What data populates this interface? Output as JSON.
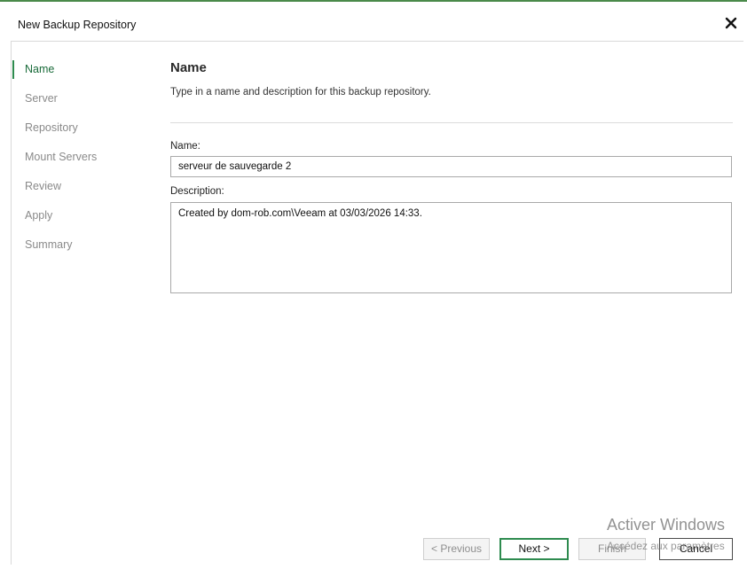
{
  "window": {
    "title": "New Backup Repository"
  },
  "icons": {
    "close": "close-icon"
  },
  "sidebar": {
    "steps": [
      {
        "label": "Name",
        "active": true
      },
      {
        "label": "Server",
        "active": false
      },
      {
        "label": "Repository",
        "active": false
      },
      {
        "label": "Mount Servers",
        "active": false
      },
      {
        "label": "Review",
        "active": false
      },
      {
        "label": "Apply",
        "active": false
      },
      {
        "label": "Summary",
        "active": false
      }
    ]
  },
  "main": {
    "title": "Name",
    "description": "Type in a name and description for this backup repository.",
    "name_label": "Name:",
    "name_value": "serveur de sauvegarde 2",
    "description_label": "Description:",
    "description_value": "Created by dom-rob.com\\Veeam at 03/03/2026 14:33."
  },
  "buttons": {
    "previous": "< Previous",
    "next": "Next >",
    "finish": "Finish",
    "cancel": "Cancel"
  },
  "watermark": {
    "title": "Activer Windows",
    "subtitle": "Accédez aux paramètres"
  },
  "colors": {
    "accent": "#2e8b4f",
    "active_step_text": "#1a6b3a",
    "inactive_step_text": "#8a8a8a"
  }
}
